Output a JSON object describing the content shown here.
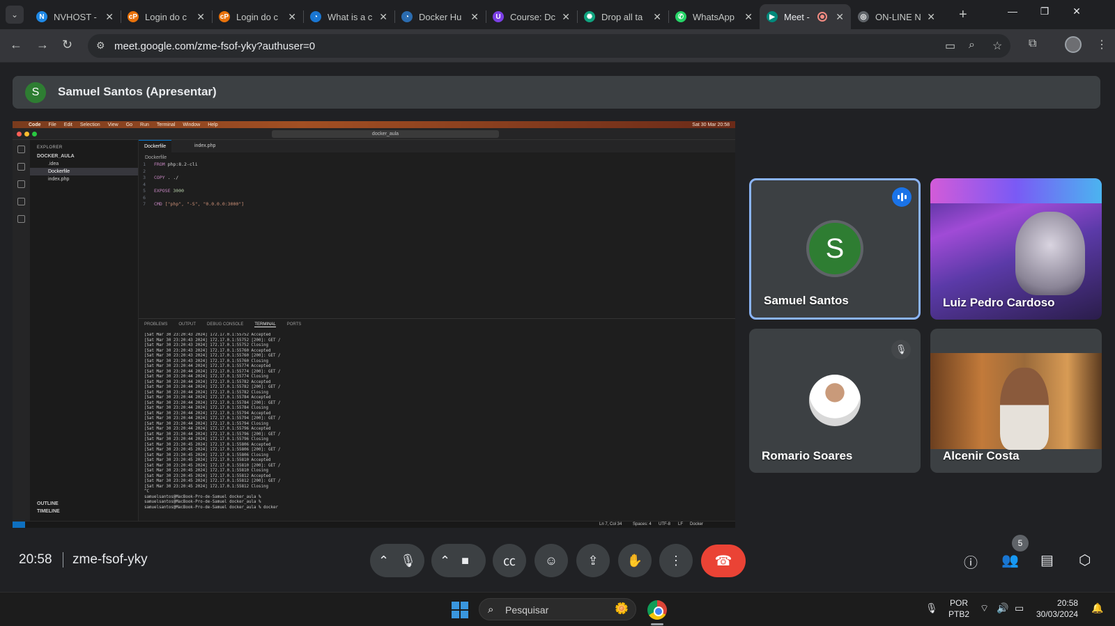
{
  "browser": {
    "tabs": [
      {
        "title": "NVHOST -",
        "favicon_color": "#1e88e5",
        "favicon_glyph": "N"
      },
      {
        "title": "Login do c",
        "favicon_color": "#e8710a",
        "favicon_glyph": "cP"
      },
      {
        "title": "Login do c",
        "favicon_color": "#e8710a",
        "favicon_glyph": "cP"
      },
      {
        "title": "What is a c",
        "favicon_color": "#1976d2",
        "favicon_glyph": "◔"
      },
      {
        "title": "Docker Hu",
        "favicon_color": "#2b6cb0",
        "favicon_glyph": "◔"
      },
      {
        "title": "Course: Dc",
        "favicon_color": "#7b3fe4",
        "favicon_glyph": "U"
      },
      {
        "title": "Drop all ta",
        "favicon_color": "#10a37f",
        "favicon_glyph": "✺"
      },
      {
        "title": "WhatsApp",
        "favicon_color": "#25d366",
        "favicon_glyph": "✆"
      },
      {
        "title": "Meet -",
        "favicon_color": "#00897b",
        "favicon_glyph": "▶",
        "active": true
      },
      {
        "title": "ON-LINE N",
        "favicon_color": "#5f6368",
        "favicon_glyph": "◎"
      }
    ],
    "url": "meet.google.com/zme-fsof-yky?authuser=0"
  },
  "meet": {
    "presenter_initial": "S",
    "presenter_label": "Samuel Santos (Apresentar)",
    "participants": [
      {
        "name": "Samuel Santos",
        "initial": "S",
        "state": "speaking"
      },
      {
        "name": "Luiz Pedro Cardoso",
        "state": "video"
      },
      {
        "name": "Romario Soares",
        "state": "muted"
      },
      {
        "name": "Alcenir Costa",
        "state": "video"
      }
    ],
    "time": "20:58",
    "meeting_code": "zme-fsof-yky",
    "people_count": "5"
  },
  "vscode": {
    "menubar": [
      "Code",
      "File",
      "Edit",
      "Selection",
      "View",
      "Go",
      "Run",
      "Terminal",
      "Window",
      "Help"
    ],
    "menubar_clock": "Sat 30 Mar  20:58",
    "search": "docker_aula",
    "explorer_title": "EXPLORER",
    "workspace": "DOCKER_AULA",
    "files": [
      ".idea",
      "Dockerfile",
      "index.php"
    ],
    "outline": "OUTLINE",
    "timeline": "TIMELINE",
    "tabs": [
      "Dockerfile",
      "index.php"
    ],
    "breadcrumb": "Dockerfile",
    "code_lines": [
      {
        "n": "1",
        "kw": "FROM",
        "rest": " php:8.2-cli"
      },
      {
        "n": "2",
        "kw": "",
        "rest": ""
      },
      {
        "n": "3",
        "kw": "COPY",
        "rest": " . ./"
      },
      {
        "n": "4",
        "kw": "",
        "rest": ""
      },
      {
        "n": "5",
        "kw": "EXPOSE",
        "rest": " 3000"
      },
      {
        "n": "6",
        "kw": "",
        "rest": ""
      },
      {
        "n": "7",
        "kw": "CMD",
        "rest": " [\"php\", \"-S\", \"0.0.0.0:3000\"]"
      }
    ],
    "panel_tabs": [
      "PROBLEMS",
      "OUTPUT",
      "DEBUG CONSOLE",
      "TERMINAL",
      "PORTS"
    ],
    "terminal_lines": [
      "[Sat Mar 30 23:20:43 2024] 172.17.0.1:55752 Accepted",
      "[Sat Mar 30 23:20:43 2024] 172.17.0.1:55752 [200]: GET /",
      "[Sat Mar 30 23:20:43 2024] 172.17.0.1:55752 Closing",
      "[Sat Mar 30 23:20:43 2024] 172.17.0.1:55760 Accepted",
      "[Sat Mar 30 23:20:43 2024] 172.17.0.1:55760 [200]: GET /",
      "[Sat Mar 30 23:20:43 2024] 172.17.0.1:55760 Closing",
      "[Sat Mar 30 23:20:44 2024] 172.17.0.1:55774 Accepted",
      "[Sat Mar 30 23:20:44 2024] 172.17.0.1:55774 [200]: GET /",
      "[Sat Mar 30 23:20:44 2024] 172.17.0.1:55774 Closing",
      "[Sat Mar 30 23:20:44 2024] 172.17.0.1:55782 Accepted",
      "[Sat Mar 30 23:20:44 2024] 172.17.0.1:55782 [200]: GET /",
      "[Sat Mar 30 23:20:44 2024] 172.17.0.1:55782 Closing",
      "[Sat Mar 30 23:20:44 2024] 172.17.0.1:55784 Accepted",
      "[Sat Mar 30 23:20:44 2024] 172.17.0.1:55784 [200]: GET /",
      "[Sat Mar 30 23:20:44 2024] 172.17.0.1:55784 Closing",
      "[Sat Mar 30 23:20:44 2024] 172.17.0.1:55794 Accepted",
      "[Sat Mar 30 23:20:44 2024] 172.17.0.1:55794 [200]: GET /",
      "[Sat Mar 30 23:20:44 2024] 172.17.0.1:55794 Closing",
      "[Sat Mar 30 23:20:44 2024] 172.17.0.1:55796 Accepted",
      "[Sat Mar 30 23:20:44 2024] 172.17.0.1:55796 [200]: GET /",
      "[Sat Mar 30 23:20:44 2024] 172.17.0.1:55796 Closing",
      "[Sat Mar 30 23:20:45 2024] 172.17.0.1:55806 Accepted",
      "[Sat Mar 30 23:20:45 2024] 172.17.0.1:55806 [200]: GET /",
      "[Sat Mar 30 23:20:45 2024] 172.17.0.1:55806 Closing",
      "[Sat Mar 30 23:20:45 2024] 172.17.0.1:55810 Accepted",
      "[Sat Mar 30 23:20:45 2024] 172.17.0.1:55810 [200]: GET /",
      "[Sat Mar 30 23:20:45 2024] 172.17.0.1:55810 Closing",
      "[Sat Mar 30 23:20:45 2024] 172.17.0.1:55812 Accepted",
      "[Sat Mar 30 23:20:45 2024] 172.17.0.1:55812 [200]: GET /",
      "[Sat Mar 30 23:20:45 2024] 172.17.0.1:55812 Closing",
      "^C",
      "samuelsantos@MacBook-Pro-de-Samuel docker_aula %",
      "samuelsantos@MacBook-Pro-de-Samuel docker_aula %",
      "samuelsantos@MacBook-Pro-de-Samuel docker_aula % docker"
    ],
    "status_position": "Ln 7, Col 34",
    "status_spaces": "Spaces: 4",
    "status_encoding": "UTF-8",
    "status_eol": "LF",
    "status_language": "Docker"
  },
  "taskbar": {
    "search_placeholder": "Pesquisar",
    "lang_line1": "POR",
    "lang_line2": "PTB2",
    "clock_time": "20:58",
    "clock_date": "30/03/2024"
  }
}
